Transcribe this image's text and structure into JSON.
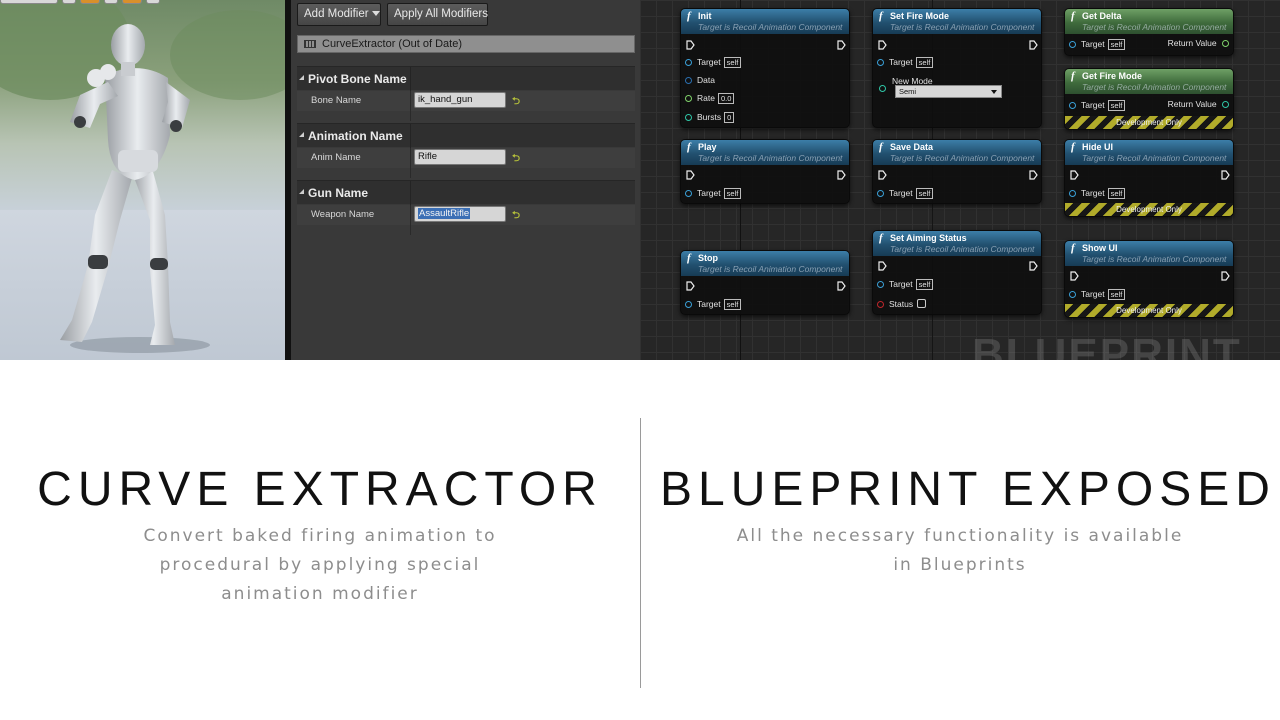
{
  "screenshot": {
    "details": {
      "add_modifier": "Add Modifier",
      "apply_all_modifiers": "Apply All Modifiers",
      "modifier_name": "CurveExtractor (Out of Date)",
      "categories": [
        {
          "title": "Pivot Bone Name",
          "field_label": "Bone Name",
          "field_value": "ik_hand_gun"
        },
        {
          "title": "Animation Name",
          "field_label": "Anim Name",
          "field_value": "Rifle"
        },
        {
          "title": "Gun Name",
          "field_label": "Weapon Name",
          "field_value": "AssaultRifle"
        }
      ],
      "reset_icon": "reset-arrow-icon"
    },
    "graph": {
      "watermark": "BLUEPRINT",
      "target_caption": "Target is Recoil Animation Component",
      "target_label": "Target",
      "self_label": "self",
      "dev_only_label": "Development Only",
      "nodes": {
        "init": {
          "name": "Init",
          "data_label": "Data",
          "rate_label": "Rate",
          "rate_value": "0.0",
          "bursts_label": "Bursts",
          "bursts_value": "0"
        },
        "set_fire_mode": {
          "name": "Set Fire Mode",
          "new_mode_label": "New Mode",
          "new_mode_value": "Semi"
        },
        "get_delta": {
          "name": "Get Delta",
          "return_label": "Return Value"
        },
        "get_fire_mode": {
          "name": "Get Fire Mode",
          "return_label": "Return Value"
        },
        "play": {
          "name": "Play"
        },
        "save_data": {
          "name": "Save Data"
        },
        "hide_ui": {
          "name": "Hide UI"
        },
        "stop": {
          "name": "Stop"
        },
        "set_aiming_status": {
          "name": "Set Aiming Status",
          "status_label": "Status"
        },
        "show_ui": {
          "name": "Show UI"
        }
      }
    }
  },
  "features": {
    "left": {
      "title": "CURVE EXTRACTOR",
      "description": "Convert baked firing animation to procedural by applying special animation modifier"
    },
    "right": {
      "title": "BLUEPRINT EXPOSED",
      "description": "All the necessary functionality is available in Blueprints"
    }
  }
}
